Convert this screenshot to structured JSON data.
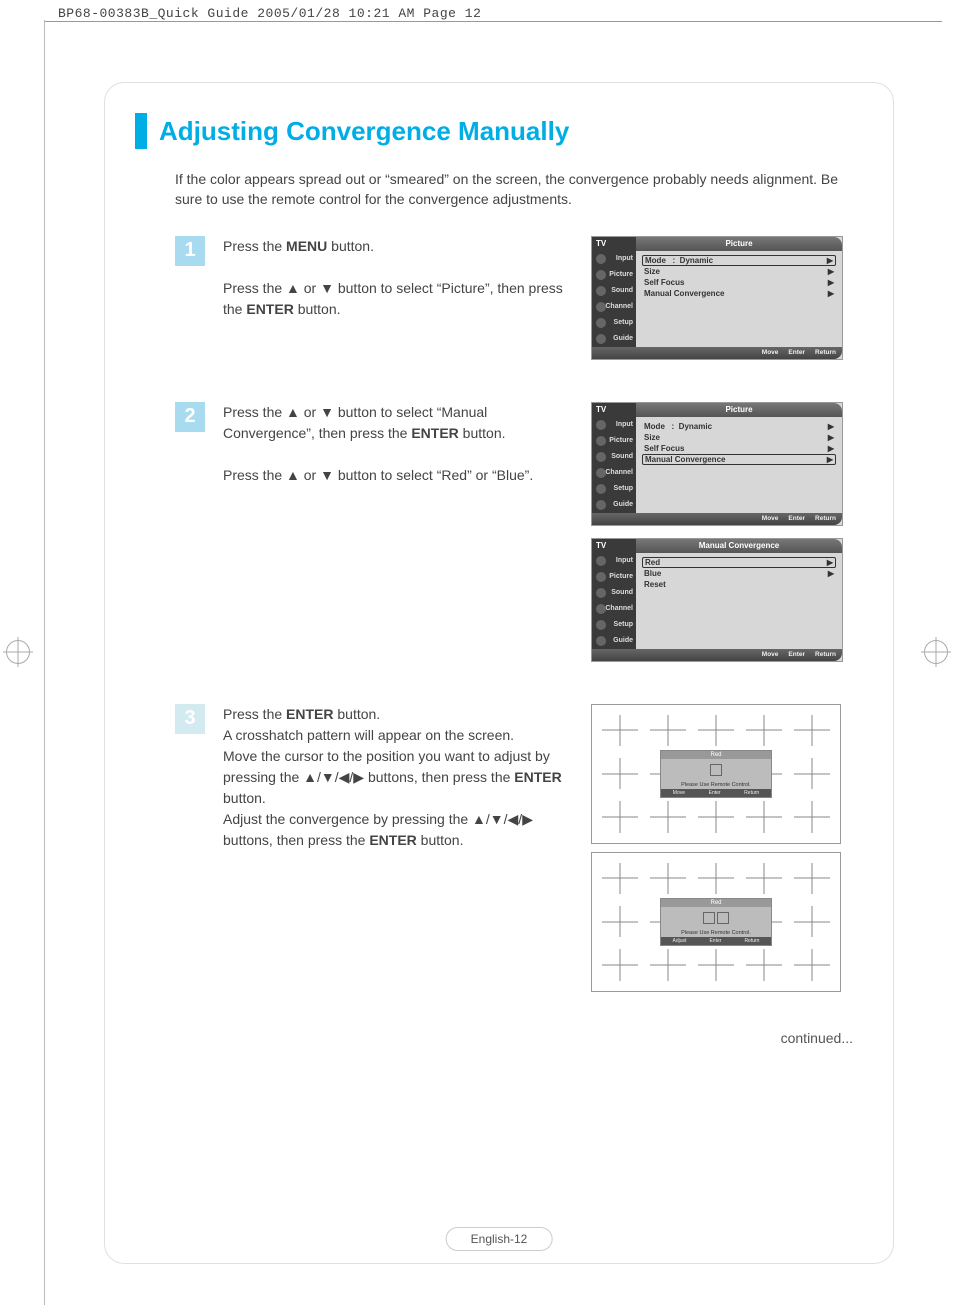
{
  "meta": {
    "header": "BP68-00383B_Quick Guide  2005/01/28  10:21 AM  Page 12"
  },
  "title": "Adjusting Convergence Manually",
  "intro": "If the color appears spread out or “smeared” on the screen, the convergence probably needs alignment. Be sure to use the remote control for the convergence adjustments.",
  "steps": [
    {
      "num": "1",
      "bold1": "MENU",
      "target": "Picture",
      "bold2": "ENTER"
    },
    {
      "num": "2",
      "target1": "Manual Convergence",
      "bold1": "ENTER",
      "opt1": "Red",
      "opt2": "Blue"
    },
    {
      "num": "3",
      "bold1": "ENTER",
      "bold2": "ENTER",
      "bold3": "ENTER"
    }
  ],
  "osd": {
    "tv": "TV",
    "pictureTitle": "Picture",
    "manualTitle": "Manual Convergence",
    "side": [
      "Input",
      "Picture",
      "Sound",
      "Channel",
      "Setup",
      "Guide"
    ],
    "rows": {
      "mode": {
        "label": "Mode",
        "value": "Dynamic"
      },
      "size": "Size",
      "selfFocus": "Self Focus",
      "manualConv": "Manual Convergence"
    },
    "convRows": [
      "Red",
      "Blue",
      "Reset"
    ],
    "footer": {
      "move": "Move",
      "enter": "Enter",
      "return": "Return"
    }
  },
  "crosshatch": {
    "header": "Red",
    "msg": "Please Use Remote Control.",
    "ft": [
      "Move",
      "Enter",
      "Return"
    ],
    "ft2": [
      "Adjust",
      "Enter",
      "Return"
    ]
  },
  "continued": "continued...",
  "pageNumber": "English-12"
}
